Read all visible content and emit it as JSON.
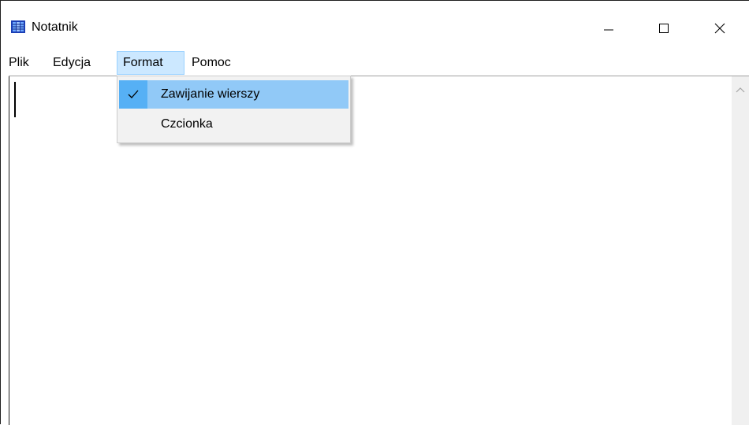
{
  "window": {
    "title": "Notatnik",
    "app_icon": "notepad-icon",
    "controls": {
      "minimize": "minimize-icon",
      "maximize": "maximize-icon",
      "close": "close-icon"
    }
  },
  "menubar": {
    "items": [
      {
        "label": "Plik"
      },
      {
        "label": "Edycja"
      },
      {
        "label": "Format",
        "active": true
      },
      {
        "label": "Pomoc"
      }
    ]
  },
  "format_menu": {
    "items": [
      {
        "label": "Zawijanie wierszy",
        "checked": true
      },
      {
        "label": "Czcionka",
        "checked": false
      }
    ]
  },
  "colors": {
    "menu_active_bg": "#cce8ff",
    "menu_item_highlight": "#91c9f7",
    "check_bg": "#56b0f5"
  },
  "editor": {
    "content": ""
  }
}
